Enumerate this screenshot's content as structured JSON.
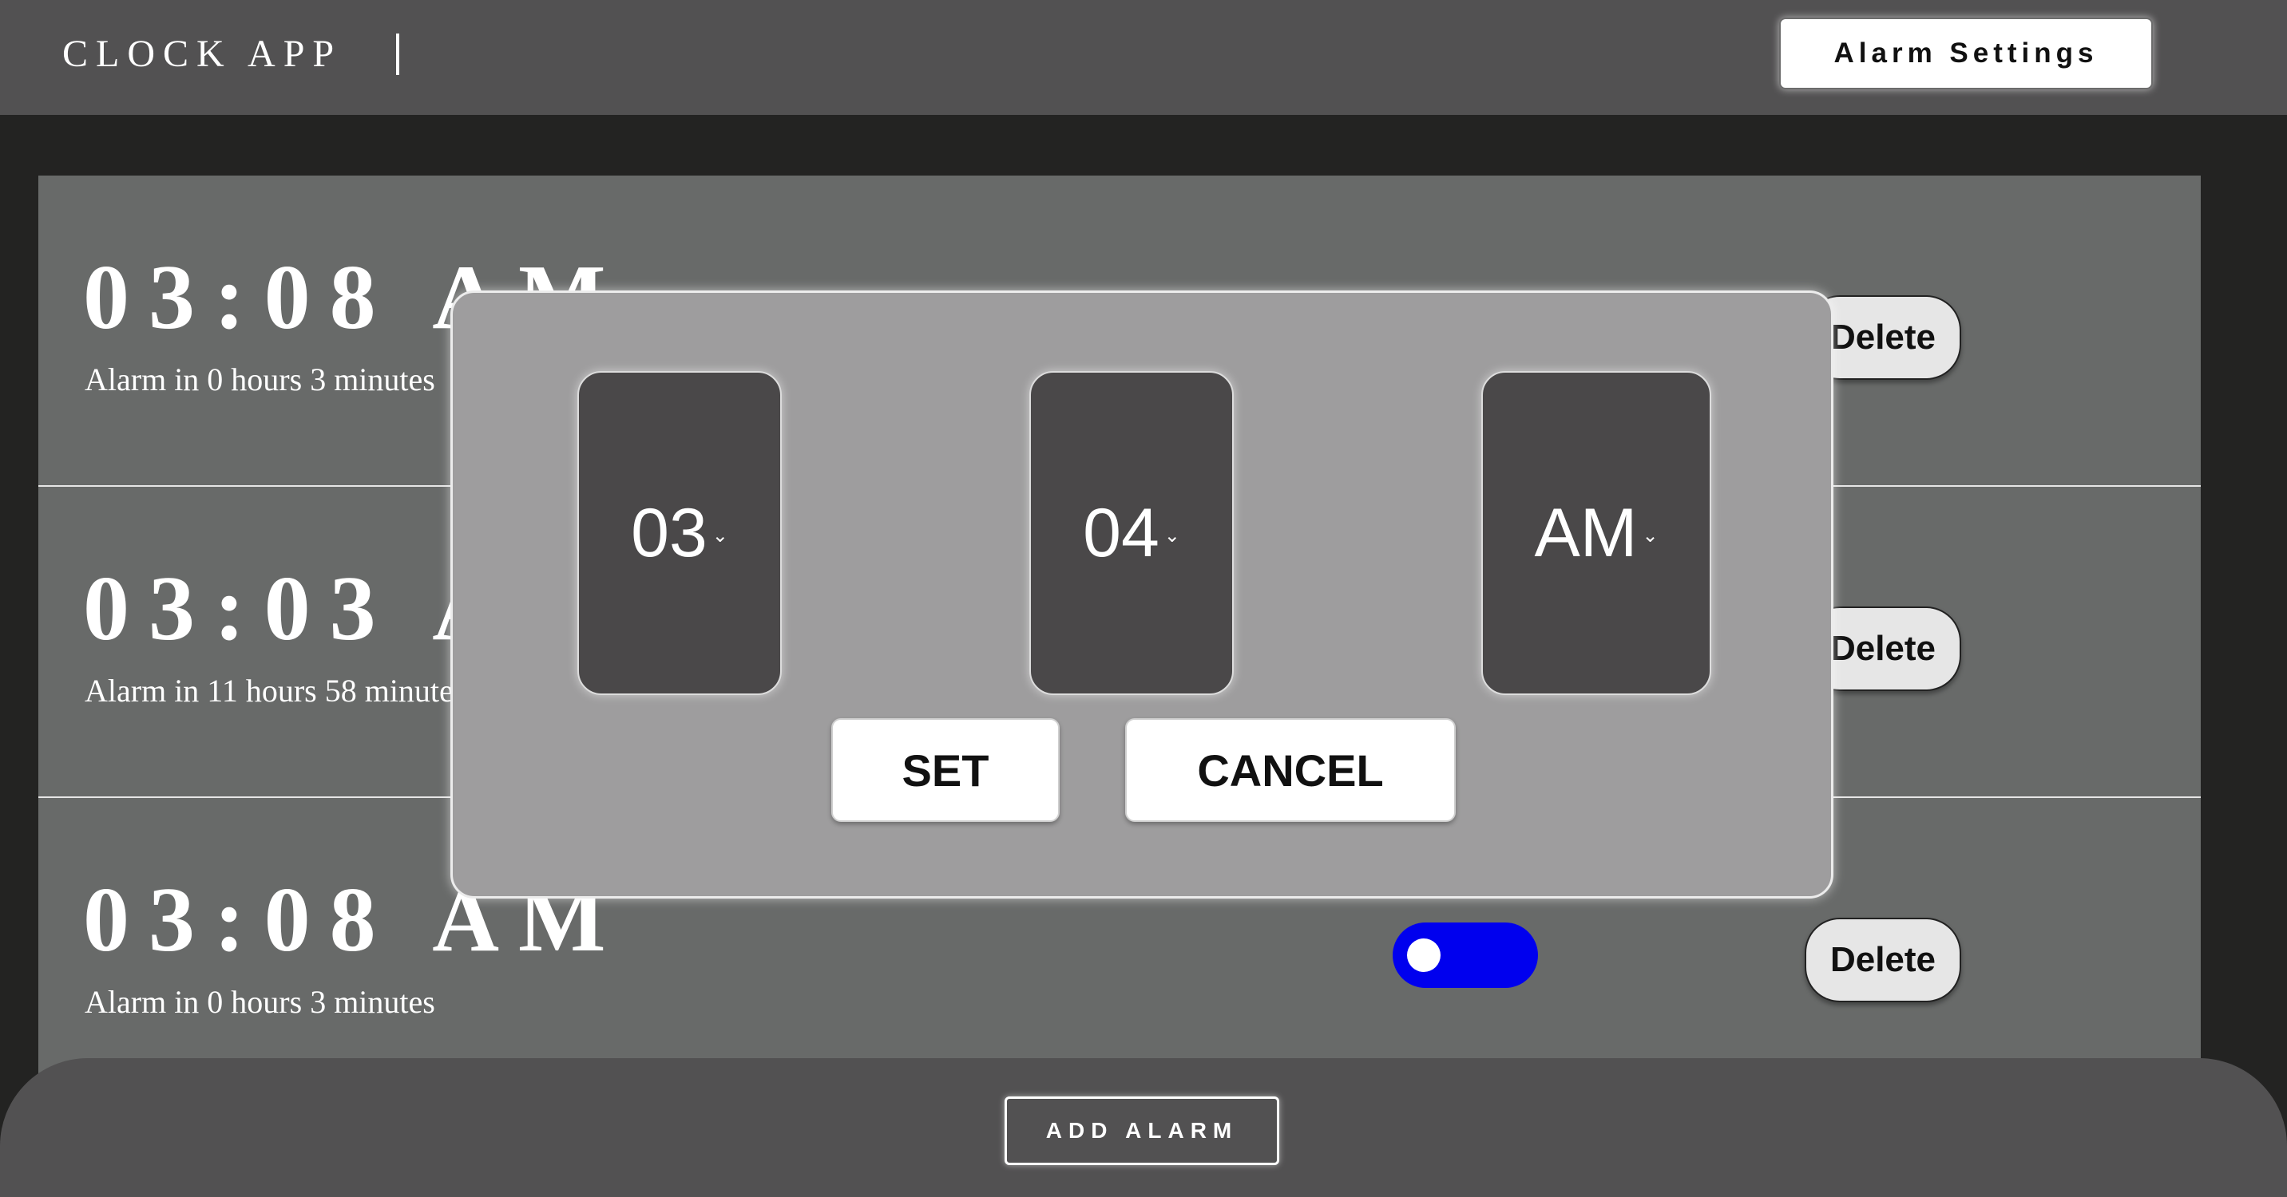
{
  "header": {
    "app_title": "CLOCK APP",
    "settings_label": "Alarm Settings"
  },
  "alarms": [
    {
      "time": "03:08 AM",
      "countdown": "Alarm in 0 hours 3 minutes",
      "delete_label": "Delete",
      "enabled": true
    },
    {
      "time": "03:03 AM",
      "countdown": "Alarm in 11 hours 58 minutes",
      "delete_label": "Delete",
      "enabled": true
    },
    {
      "time": "03:08 AM",
      "countdown": "Alarm in 0 hours 3 minutes",
      "delete_label": "Delete",
      "enabled": true
    }
  ],
  "modal": {
    "hour": "03",
    "minute": "04",
    "period": "AM",
    "caret": "⌄",
    "set_label": "SET",
    "cancel_label": "CANCEL"
  },
  "footer": {
    "add_label": "ADD ALARM"
  },
  "colors": {
    "toggle_on": "#0000ee",
    "header_bg": "#525152",
    "list_bg": "#686a69",
    "modal_bg": "#9e9d9e"
  }
}
